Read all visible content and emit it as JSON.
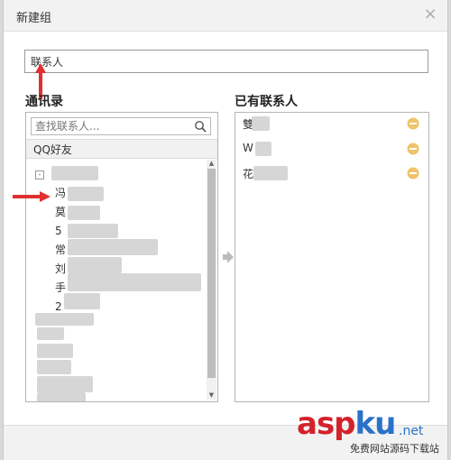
{
  "dialog": {
    "title": "新建组",
    "close_symbol": "×"
  },
  "group_name": {
    "value": "联系人"
  },
  "left": {
    "heading": "通讯录",
    "search_placeholder": "查找联系人...",
    "group_label": "QQ好友",
    "toggle_symbol": "-",
    "visible_fragments": [
      "冯",
      "莫",
      "5",
      "常",
      "刘",
      "手",
      "2"
    ]
  },
  "right": {
    "heading": "已有联系人",
    "contacts": [
      {
        "name": "雙"
      },
      {
        "name": "W"
      },
      {
        "name": "花"
      }
    ]
  },
  "colors": {
    "remove_icon": "#efc36a",
    "arrow": "#e03030",
    "transfer_arrow": "#bbbbbb"
  },
  "watermark": {
    "asp": "asp",
    "ku": "ku",
    "net": ".net",
    "sub": "免费网站源码下载站"
  }
}
